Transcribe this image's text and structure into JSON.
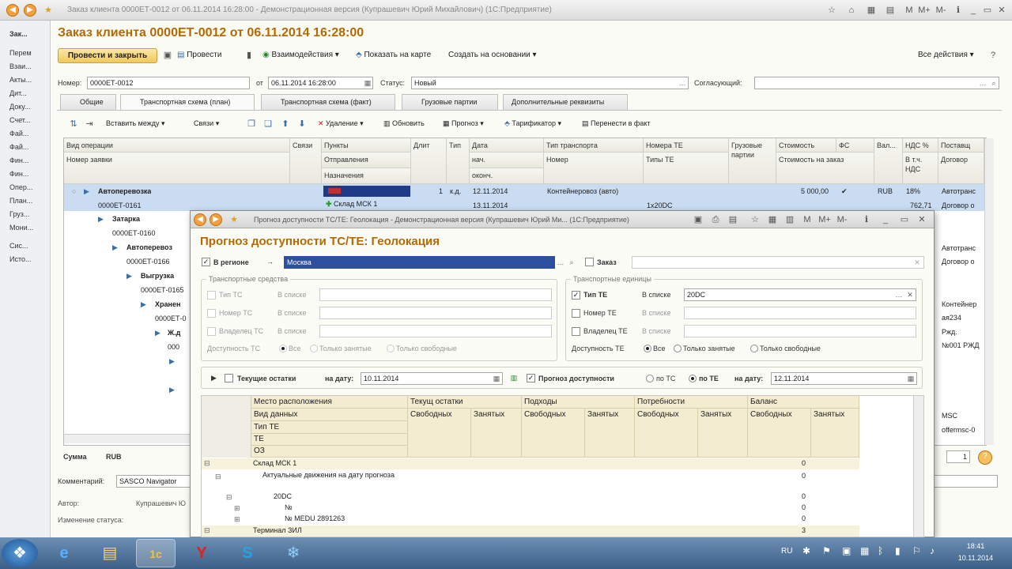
{
  "window": {
    "title": "Заказ клиента 0000ЕТ-0012 от 06.11.2014 16:28:00 - Демонстрационная версия (Купрашевич Юрий Михайлович) (1С:Предприятие)",
    "controls": [
      "M",
      "M+",
      "M-"
    ]
  },
  "leftnav": [
    "Зак...",
    "Перем",
    "Взаи...",
    "Акты...",
    "Дит...",
    "Доку...",
    "Счет...",
    "Фай...",
    "Фай...",
    "Фин...",
    "Фин...",
    "Опер...",
    "План...",
    "Груз...",
    "Мони...",
    "Сис...",
    "Исто..."
  ],
  "doc": {
    "title": "Заказ клиента 0000ЕТ-0012 от 06.11.2014 16:28:00",
    "toolbar": {
      "post_close": "Провести и закрыть",
      "post": "Провести",
      "interactions": "Взаимодействия",
      "map": "Показать на карте",
      "create_based": "Создать на основании",
      "all_actions": "Все действия"
    },
    "number_label": "Номер:",
    "number": "0000ЕТ-0012",
    "from_label": "от",
    "date": "06.11.2014 16:28:00",
    "status_label": "Статус:",
    "status": "Новый",
    "approver_label": "Согласующий:",
    "approver": ""
  },
  "tabs": [
    "Общие",
    "Транспортная схема (план)",
    "Транспортная схема (факт)",
    "Грузовые партии",
    "Дополнительные реквизиты"
  ],
  "grid_toolbar": {
    "insert_between": "Вставить между",
    "links": "Связи",
    "delete": "Удаление",
    "refresh": "Обновить",
    "forecast": "Прогноз",
    "tariff": "Тарификатор",
    "to_fact": "Перенести в факт"
  },
  "grid": {
    "headers": {
      "op_type": "Вид операции",
      "links": "Связи",
      "points": "Пункты",
      "length": "Длит",
      "type": "Тип",
      "date": "Дата",
      "transport_type": "Тип транспорта",
      "te_number": "Номера ТЕ",
      "cargo": "Грузовые",
      "cargo2": "партии",
      "cost": "Стоимость",
      "fs": "ФС",
      "cur": "Вал...",
      "vat": "НДС %",
      "supplier": "Поставщ",
      "request_no": "Номер заявки",
      "departure": "Отправления",
      "destination": "Назначения",
      "start": "нач.",
      "end": "оконч.",
      "number": "Номер",
      "te_types": "Типы ТЕ",
      "cost_order": "Стоимость на заказ",
      "incl_vat": "В т.ч.",
      "vat2": "НДС",
      "contract": "Договор"
    },
    "row1": {
      "op": "Автоперевозка",
      "request": "0000ЕТ-0161",
      "len": "1",
      "type": "к.д.",
      "date1": "12.11.2014",
      "date2": "13.11.2014",
      "transport": "Контейнеровоз (авто)",
      "te_types": "1х20DC",
      "point2": "Склад МСК 1",
      "cost": "5 000,00",
      "check": "✔",
      "cur": "RUB",
      "vat": "18%",
      "vat_sum": "762,71",
      "supplier": "Автотранс",
      "contract": "Договор о"
    },
    "tree": [
      {
        "label": "Затарка",
        "sub": "0000ЕТ-0160"
      },
      {
        "label": "Автоперевоз",
        "sub": "0000ЕТ-0166"
      },
      {
        "label": "Выгрузка",
        "sub": "0000ЕТ-0165"
      },
      {
        "label": "Хранен",
        "sub": "0000ЕТ-0"
      },
      {
        "label": "Ж.д",
        "sub": "000"
      }
    ],
    "right_col": [
      "Автотранс",
      "Договор о",
      "Контейнер",
      "ая234",
      "Ржд.",
      "№001 РЖД",
      "MSC",
      "offermsc-0"
    ]
  },
  "footer": {
    "sum_label": "Сумма",
    "currency": "RUB",
    "comment_label": "Комментарий:",
    "comment": "SASCO Navigator",
    "author_label": "Автор:",
    "author": "Купрашевич Ю",
    "status_change_label": "Изменение статуса:",
    "page": "1"
  },
  "dialog": {
    "title": "Прогноз доступности ТС/ТЕ: Геолокация - Демонстрационная версия (Купрашевич Юрий Ми... (1С:Предприятие)",
    "heading": "Прогноз доступности ТС/ТЕ: Геолокация",
    "in_region": "В регионе",
    "region": "Москва",
    "order_label": "Заказ",
    "vehicles_group": "Транспортные средства",
    "units_group": "Транспортные единицы",
    "vehicle_rows": [
      "Тип ТС",
      "Номер ТС",
      "Владелец ТС"
    ],
    "unit_rows": [
      "Тип ТЕ",
      "Номер ТЕ",
      "Владелец ТЕ"
    ],
    "in_list": "В списке",
    "te_type_value": "20DC",
    "availability_ts": "Доступность ТС",
    "availability_te": "Доступность ТЕ",
    "avail_options": [
      "Все",
      "Только занятые",
      "Только свободные"
    ],
    "current_stock": "Текущие остатки",
    "on_date": "на дату:",
    "stock_date": "10.11.2014",
    "forecast_label": "Прогноз доступности",
    "by_ts": "по ТС",
    "by_te": "по ТЕ",
    "forecast_date": "12.11.2014",
    "pivot": {
      "location": "Место расположения",
      "data_kind": "Вид данных",
      "te_type": "Тип ТЕ",
      "te": "ТЕ",
      "oz": "ОЗ",
      "groups": [
        "Текущ остатки",
        "Подходы",
        "Потребности",
        "Баланс"
      ],
      "free": "Свободных",
      "busy": "Занятых",
      "rows": [
        {
          "label": "Склад МСК 1",
          "value": "0",
          "indent": 0
        },
        {
          "label": "Актуальные движения на дату прогноза",
          "value": "0",
          "indent": 1
        },
        {
          "label": "20DC",
          "value": "0",
          "indent": 2
        },
        {
          "label": "№",
          "value": "0",
          "indent": 3
        },
        {
          "label": "№ MEDU 2891263",
          "value": "0",
          "indent": 3
        },
        {
          "label": "Терминал ЗИЛ",
          "value": "3",
          "indent": 0
        }
      ]
    }
  },
  "taskbar": {
    "lang": "RU",
    "time": "18:41",
    "date": "10.11.2014"
  }
}
